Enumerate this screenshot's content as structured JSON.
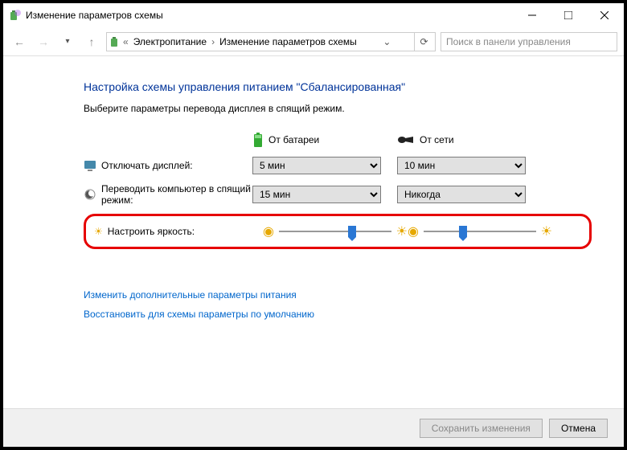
{
  "titlebar": {
    "title": "Изменение параметров схемы"
  },
  "breadcrumb": {
    "item1": "Электропитание",
    "item2": "Изменение параметров схемы"
  },
  "search": {
    "placeholder": "Поиск в панели управления"
  },
  "heading": "Настройка схемы управления питанием \"Сбалансированная\"",
  "subheading": "Выберите параметры перевода дисплея в спящий режим.",
  "columns": {
    "battery": "От батареи",
    "plugged": "От сети"
  },
  "rows": {
    "display_off": "Отключать дисплей:",
    "sleep": "Переводить компьютер в спящий режим:",
    "brightness": "Настроить яркость:"
  },
  "values": {
    "display_off_battery": "5 мин",
    "display_off_plugged": "10 мин",
    "sleep_battery": "15 мин",
    "sleep_plugged": "Никогда"
  },
  "links": {
    "advanced": "Изменить дополнительные параметры питания",
    "restore": "Восстановить для схемы параметры по умолчанию"
  },
  "buttons": {
    "save": "Сохранить изменения",
    "cancel": "Отмена"
  }
}
